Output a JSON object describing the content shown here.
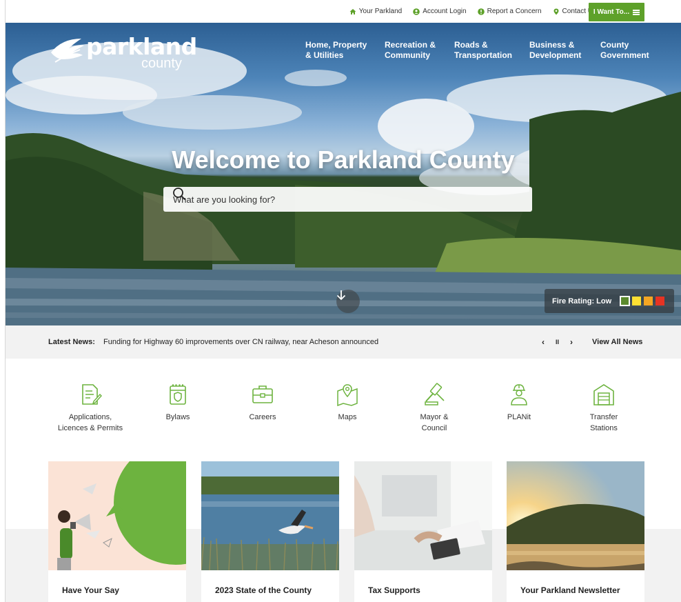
{
  "utility": {
    "links": [
      "Your Parkland",
      "Account Login",
      "Report a Concern",
      "Contact Us"
    ],
    "want_label": "I Want To..."
  },
  "logo": {
    "word": "parkland",
    "sub": "county"
  },
  "nav": [
    "Home, Property\n& Utilities",
    "Recreation &\nCommunity",
    "Roads &\nTransportation",
    "Business &\nDevelopment",
    "County\nGovernment"
  ],
  "hero": {
    "title": "Welcome to Parkland County",
    "search_placeholder": "What are you looking for?"
  },
  "fire": {
    "label": "Fire Rating: Low",
    "colors": [
      "#5c8a2e",
      "#ffe033",
      "#f5a623",
      "#e63323"
    ],
    "selected_index": 0
  },
  "news": {
    "label": "Latest News:",
    "headline": "Funding for Highway 60 improvements over CN railway, near Acheson announced",
    "prev": "‹",
    "pause": "II",
    "next": "›",
    "view_all": "View All News"
  },
  "quick_links": [
    {
      "label": "Applications,\nLicences & Permits",
      "icon": "document-icon"
    },
    {
      "label": "Bylaws",
      "icon": "calendar-badge-icon"
    },
    {
      "label": "Careers",
      "icon": "briefcase-icon"
    },
    {
      "label": "Maps",
      "icon": "map-pin-icon"
    },
    {
      "label": "Mayor &\nCouncil",
      "icon": "gavel-icon"
    },
    {
      "label": "PLANit",
      "icon": "worker-icon"
    },
    {
      "label": "Transfer\nStations",
      "icon": "garage-icon"
    }
  ],
  "cards": [
    {
      "title": "Have Your Say"
    },
    {
      "title": "2023 State of the County"
    },
    {
      "title": "Tax Supports"
    },
    {
      "title": "Your Parkland Newsletter"
    }
  ],
  "colors": {
    "brand_green": "#5ea12a",
    "icon_green": "#6db33f"
  }
}
